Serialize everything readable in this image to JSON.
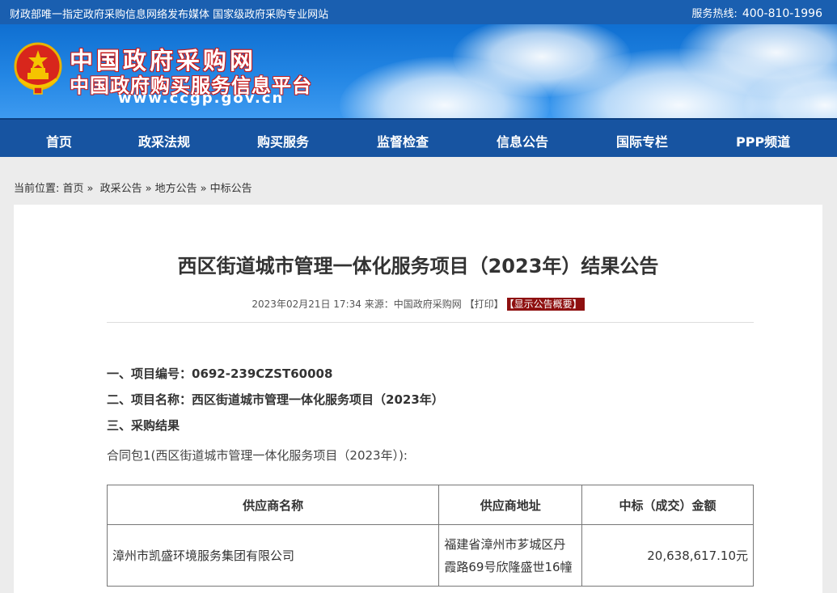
{
  "topbar": {
    "left_text": "财政部唯一指定政府采购信息网络发布媒体 国家级政府采购专业网站",
    "hotline_label": "服务热线:",
    "hotline_number": "400-810-1996"
  },
  "brand": {
    "title_line1": "中国政府采购网",
    "title_line2": "中国政府购买服务信息平台",
    "url": "www.ccgp.gov.cn"
  },
  "nav": {
    "items": [
      "首页",
      "政采法规",
      "购买服务",
      "监督检查",
      "信息公告",
      "国际专栏",
      "PPP频道"
    ]
  },
  "breadcrumb": {
    "label": "当前位置:",
    "items": [
      "首页",
      "政采公告",
      "地方公告",
      "中标公告"
    ],
    "sep": "»"
  },
  "article": {
    "title": "西区街道城市管理一体化服务项目（2023年）结果公告",
    "date": "2023年02月21日 17:34",
    "source": "来源：中国政府采购网",
    "print_label": "【打印】",
    "summary_label": "【显示公告概要】",
    "sections": [
      "一、项目编号：0692-239CZST60008",
      "二、项目名称：西区街道城市管理一体化服务项目（2023年）",
      "三、采购结果"
    ],
    "package_text": "合同包1(西区街道城市管理一体化服务项目（2023年）):"
  },
  "table": {
    "headers": [
      "供应商名称",
      "供应商地址",
      "中标（成交）金额"
    ],
    "rows": [
      [
        "漳州市凯盛环境服务集团有限公司",
        "福建省漳州市芗城区丹霞路69号欣隆盛世16幢",
        "20,638,617.10元"
      ]
    ]
  },
  "colors": {
    "topbar": "#1a5fb0",
    "nav": "#1754a1",
    "badge": "#8e1010"
  }
}
